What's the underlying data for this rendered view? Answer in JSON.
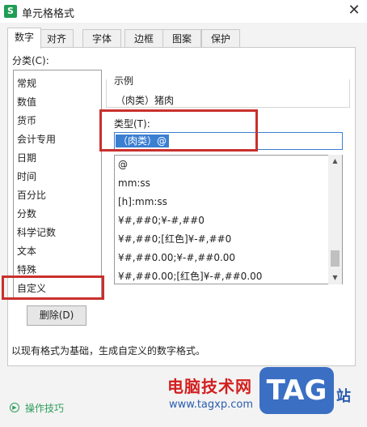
{
  "window": {
    "title": "单元格格式",
    "app_icon_letter": "S",
    "close_glyph": "✕"
  },
  "tabs": [
    "数字",
    "对齐",
    "字体",
    "边框",
    "图案",
    "保护"
  ],
  "category": {
    "label": "分类(C):",
    "items": [
      "常规",
      "数值",
      "货币",
      "会计专用",
      "日期",
      "时间",
      "百分比",
      "分数",
      "科学记数",
      "文本",
      "特殊",
      "自定义"
    ],
    "selected": "自定义"
  },
  "example": {
    "label": "示例",
    "value": "（肉类）猪肉"
  },
  "type": {
    "label": "类型(T):",
    "input_value": "（肉类）@",
    "formats": [
      "@",
      "mm:ss",
      "[h]:mm:ss",
      "¥#,##0;¥-#,##0",
      "¥#,##0;[红色]¥-#,##0",
      "¥#,##0.00;¥-#,##0.00",
      "¥#,##0.00;[红色]¥-#,##0.00"
    ]
  },
  "delete_button": "删除(D)",
  "description": "以现有格式为基础，生成自定义的数字格式。",
  "tips": {
    "label": "操作技巧"
  },
  "watermark": {
    "site_name": "电脑技术网",
    "url": "www.tagxp.com",
    "logo": "TAG",
    "suffix": "站"
  },
  "colors": {
    "accent": "#3b7fd1",
    "highlight_box": "#c9302c",
    "tips": "#2e9d5b"
  }
}
